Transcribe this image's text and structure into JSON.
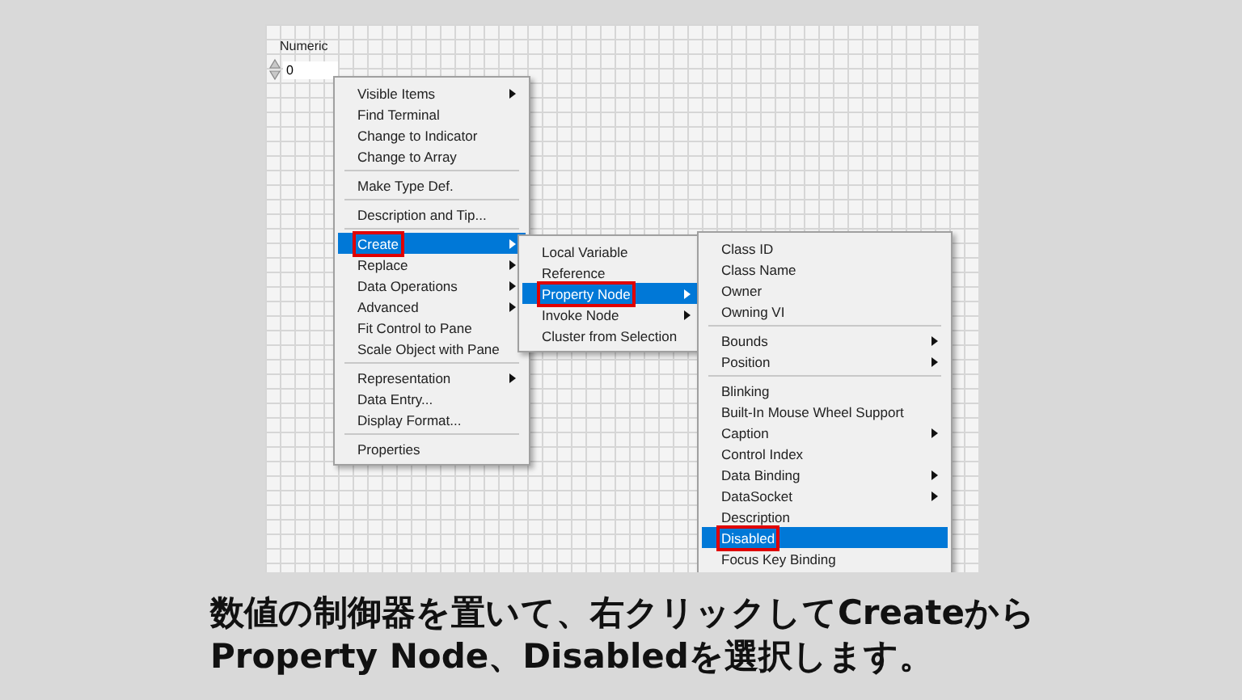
{
  "numeric": {
    "label": "Numeric",
    "value": "0"
  },
  "menus": [
    {
      "items": [
        {
          "kind": "item",
          "label": "Visible Items",
          "submenu": true,
          "selected": false,
          "marked": false
        },
        {
          "kind": "item",
          "label": "Find Terminal",
          "submenu": false,
          "selected": false,
          "marked": false
        },
        {
          "kind": "item",
          "label": "Change to Indicator",
          "submenu": false,
          "selected": false,
          "marked": false
        },
        {
          "kind": "item",
          "label": "Change to Array",
          "submenu": false,
          "selected": false,
          "marked": false
        },
        {
          "kind": "separator"
        },
        {
          "kind": "item",
          "label": "Make Type Def.",
          "submenu": false,
          "selected": false,
          "marked": false
        },
        {
          "kind": "separator"
        },
        {
          "kind": "item",
          "label": "Description and Tip...",
          "submenu": false,
          "selected": false,
          "marked": false
        },
        {
          "kind": "separator"
        },
        {
          "kind": "item",
          "label": "Create",
          "submenu": true,
          "selected": true,
          "marked": true
        },
        {
          "kind": "item",
          "label": "Replace",
          "submenu": true,
          "selected": false,
          "marked": false
        },
        {
          "kind": "item",
          "label": "Data Operations",
          "submenu": true,
          "selected": false,
          "marked": false
        },
        {
          "kind": "item",
          "label": "Advanced",
          "submenu": true,
          "selected": false,
          "marked": false
        },
        {
          "kind": "item",
          "label": "Fit Control to Pane",
          "submenu": false,
          "selected": false,
          "marked": false
        },
        {
          "kind": "item",
          "label": "Scale Object with Pane",
          "submenu": false,
          "selected": false,
          "marked": false
        },
        {
          "kind": "separator"
        },
        {
          "kind": "item",
          "label": "Representation",
          "submenu": true,
          "selected": false,
          "marked": false
        },
        {
          "kind": "item",
          "label": "Data Entry...",
          "submenu": false,
          "selected": false,
          "marked": false
        },
        {
          "kind": "item",
          "label": "Display Format...",
          "submenu": false,
          "selected": false,
          "marked": false
        },
        {
          "kind": "separator"
        },
        {
          "kind": "item",
          "label": "Properties",
          "submenu": false,
          "selected": false,
          "marked": false
        }
      ]
    },
    {
      "items": [
        {
          "kind": "item",
          "label": "Local Variable",
          "submenu": false,
          "selected": false,
          "marked": false
        },
        {
          "kind": "item",
          "label": "Reference",
          "submenu": false,
          "selected": false,
          "marked": false
        },
        {
          "kind": "item",
          "label": "Property Node",
          "submenu": true,
          "selected": true,
          "marked": true
        },
        {
          "kind": "item",
          "label": "Invoke Node",
          "submenu": true,
          "selected": false,
          "marked": false
        },
        {
          "kind": "item",
          "label": "Cluster from Selection",
          "submenu": false,
          "selected": false,
          "marked": false
        }
      ]
    },
    {
      "items": [
        {
          "kind": "item",
          "label": "Class ID",
          "submenu": false,
          "selected": false,
          "marked": false
        },
        {
          "kind": "item",
          "label": "Class Name",
          "submenu": false,
          "selected": false,
          "marked": false
        },
        {
          "kind": "item",
          "label": "Owner",
          "submenu": false,
          "selected": false,
          "marked": false
        },
        {
          "kind": "item",
          "label": "Owning VI",
          "submenu": false,
          "selected": false,
          "marked": false
        },
        {
          "kind": "separator"
        },
        {
          "kind": "item",
          "label": "Bounds",
          "submenu": true,
          "selected": false,
          "marked": false
        },
        {
          "kind": "item",
          "label": "Position",
          "submenu": true,
          "selected": false,
          "marked": false
        },
        {
          "kind": "separator"
        },
        {
          "kind": "item",
          "label": "Blinking",
          "submenu": false,
          "selected": false,
          "marked": false
        },
        {
          "kind": "item",
          "label": "Built-In Mouse Wheel Support",
          "submenu": false,
          "selected": false,
          "marked": false
        },
        {
          "kind": "item",
          "label": "Caption",
          "submenu": true,
          "selected": false,
          "marked": false
        },
        {
          "kind": "item",
          "label": "Control Index",
          "submenu": false,
          "selected": false,
          "marked": false
        },
        {
          "kind": "item",
          "label": "Data Binding",
          "submenu": true,
          "selected": false,
          "marked": false
        },
        {
          "kind": "item",
          "label": "DataSocket",
          "submenu": true,
          "selected": false,
          "marked": false
        },
        {
          "kind": "item",
          "label": "Description",
          "submenu": false,
          "selected": false,
          "marked": false
        },
        {
          "kind": "item",
          "label": "Disabled",
          "submenu": false,
          "selected": true,
          "marked": true
        },
        {
          "kind": "item",
          "label": "Focus Key Binding",
          "submenu": false,
          "selected": false,
          "marked": false
        }
      ]
    }
  ],
  "caption": "数値の制御器を置いて、右クリックしてCreateから\nProperty Node、Disabledを選択します。"
}
